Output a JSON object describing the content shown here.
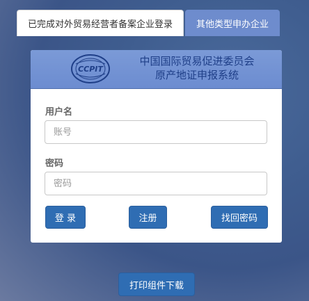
{
  "tabs": [
    {
      "label": "已完成对外贸易经营者备案企业登录",
      "active": true
    },
    {
      "label": "其他类型申办企业",
      "active": false
    }
  ],
  "banner": {
    "logo_text": "CCPIT",
    "title_line1": "中国国际贸易促进委员会",
    "title_line2": "原产地证申报系统"
  },
  "form": {
    "username_label": "用户名",
    "username_placeholder": "账号",
    "password_label": "密码",
    "password_placeholder": "密码"
  },
  "buttons": {
    "login": "登 录",
    "register": "注册",
    "recover": "找回密码"
  },
  "download_button": "打印组件下载",
  "colors": {
    "primary_button": "#2f6db3",
    "inactive_tab": "#6e8ccd",
    "banner": "#7394d3",
    "banner_text": "#1f3f88"
  },
  "icons": {
    "logo": "ccpit-logo-icon"
  }
}
